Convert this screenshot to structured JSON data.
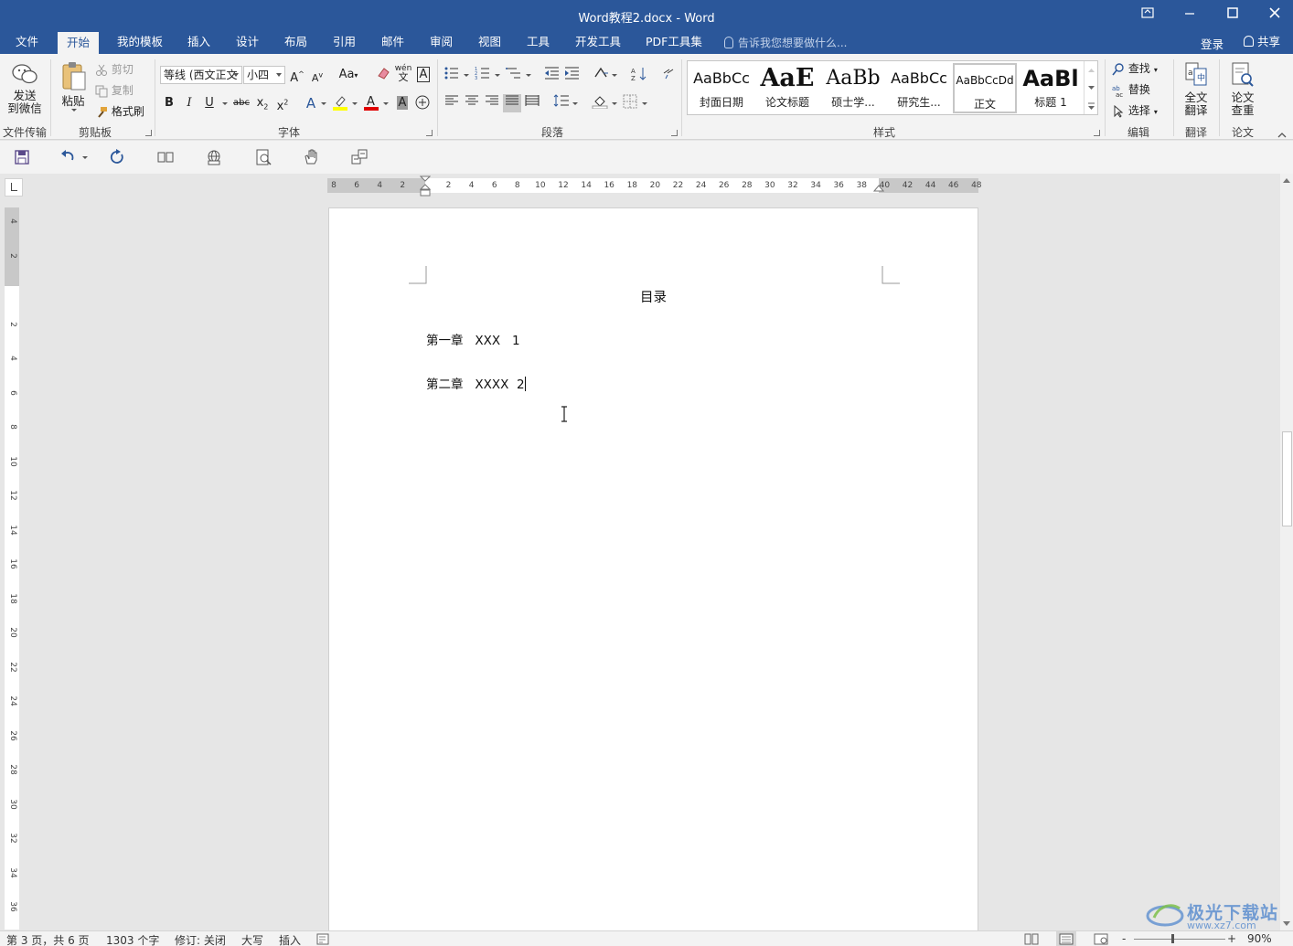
{
  "window": {
    "title": "Word教程2.docx - Word",
    "buttons": [
      "ribbon-display",
      "minimize",
      "maximize",
      "close"
    ]
  },
  "tabs": [
    {
      "label": "文件",
      "active": false
    },
    {
      "label": "开始",
      "active": true
    },
    {
      "label": "我的模板",
      "active": false
    },
    {
      "label": "插入",
      "active": false
    },
    {
      "label": "设计",
      "active": false
    },
    {
      "label": "布局",
      "active": false
    },
    {
      "label": "引用",
      "active": false
    },
    {
      "label": "邮件",
      "active": false
    },
    {
      "label": "审阅",
      "active": false
    },
    {
      "label": "视图",
      "active": false
    },
    {
      "label": "工具",
      "active": false
    },
    {
      "label": "开发工具",
      "active": false
    },
    {
      "label": "PDF工具集",
      "active": false
    }
  ],
  "tell_me": "告诉我您想要做什么...",
  "account": {
    "login": "登录",
    "share": "共享"
  },
  "ribbon": {
    "file_transfer": {
      "send_line1": "发送",
      "send_line2": "到微信",
      "label": "文件传输"
    },
    "clipboard": {
      "paste": "粘贴",
      "cut": "剪切",
      "copy": "复制",
      "format_painter": "格式刷",
      "label": "剪贴板"
    },
    "font": {
      "font_name": "等线 (西文正文",
      "font_size": "小四",
      "label": "字体",
      "change_case": "Aa",
      "phonetic": "wén",
      "phonetic_sub": "文"
    },
    "paragraph": {
      "label": "段落"
    },
    "styles": {
      "label": "样式",
      "items": [
        {
          "preview": "AaBbCc",
          "name": "封面日期",
          "selected": false
        },
        {
          "preview": "AaE",
          "name": "论文标题",
          "selected": false
        },
        {
          "preview": "AaBb",
          "name": "硕士学...",
          "selected": false
        },
        {
          "preview": "AaBbCc",
          "name": "研究生...",
          "selected": false
        },
        {
          "preview": "AaBbCcDd",
          "name": "正文",
          "selected": true
        },
        {
          "preview": "AaBl",
          "name": "标题 1",
          "selected": false
        }
      ]
    },
    "editing": {
      "find": "查找",
      "replace": "替换",
      "select": "选择",
      "label": "编辑"
    },
    "translate": {
      "line1": "全文",
      "line2": "翻译",
      "label": "翻译"
    },
    "paper": {
      "line1": "论文",
      "line2": "查重",
      "label": "论文"
    }
  },
  "rulers": {
    "horizontal_ticks": [
      "8",
      "6",
      "4",
      "2",
      "",
      "2",
      "4",
      "6",
      "8",
      "10",
      "12",
      "14",
      "16",
      "18",
      "20",
      "22",
      "24",
      "26",
      "28",
      "30",
      "32",
      "34",
      "36",
      "38",
      "40",
      "42",
      "44",
      "46",
      "48"
    ],
    "vertical_ticks": [
      "4",
      "2",
      "",
      "2",
      "4",
      "6",
      "8",
      "10",
      "12",
      "14",
      "16",
      "18",
      "20",
      "22",
      "24",
      "26",
      "28",
      "30",
      "32",
      "34",
      "36"
    ]
  },
  "document": {
    "heading": "目录",
    "toc": [
      {
        "chapter": "第一章",
        "title": "XXX",
        "page": "1"
      },
      {
        "chapter": "第二章",
        "title": "XXXX",
        "page": "2"
      }
    ]
  },
  "status": {
    "page": "第 3 页，共 6 页",
    "words": "1303 个字",
    "track_changes": "修订: 关闭",
    "caps": "大写",
    "insert_mode": "插入",
    "zoom_minus": "-",
    "zoom_plus": "+",
    "zoom": "90%",
    "zoom_level_percent": 90
  },
  "watermark": {
    "main": "极光下载站",
    "sub": "www.xz7.com"
  },
  "colors": {
    "brand": "#2b579a",
    "ribbon_bg": "#f3f3f3",
    "doc_bg": "#e6e6e6",
    "highlight": "#ffff00",
    "font_color": "#e00000"
  }
}
